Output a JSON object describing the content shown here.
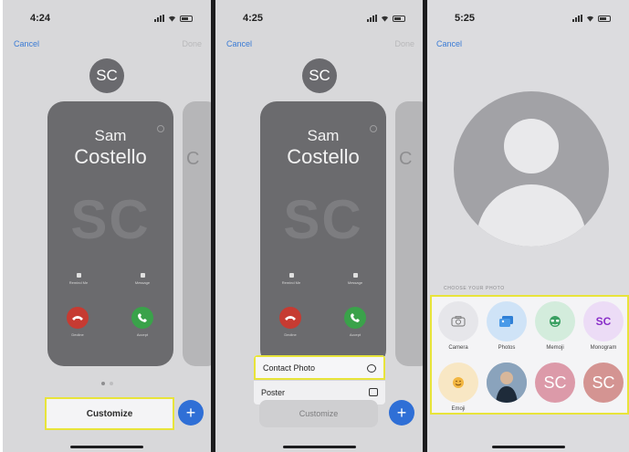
{
  "panels": [
    {
      "time": "4:24",
      "cancel": "Cancel",
      "done": "Done",
      "avatar_initials": "SC",
      "card": {
        "first_name": "Sam",
        "last_name": "Costello",
        "monogram": "SC",
        "remind_me": "Remind Me",
        "message": "Message",
        "decline": "Decline",
        "accept": "Accept"
      },
      "peek_letter": "C",
      "customize_label": "Customize",
      "plus": "+"
    },
    {
      "time": "4:25",
      "cancel": "Cancel",
      "done": "Done",
      "avatar_initials": "SC",
      "card": {
        "first_name": "Sam",
        "last_name": "Costello",
        "monogram": "SC",
        "remind_me": "Remind Me",
        "message": "Message",
        "decline": "Decline",
        "accept": "Accept"
      },
      "peek_letter": "C",
      "menu": [
        {
          "label": "Contact Photo",
          "icon": "person-circle-icon"
        },
        {
          "label": "Poster",
          "icon": "poster-icon"
        }
      ],
      "customize_label": "Customize",
      "plus": "+"
    },
    {
      "time": "5:25",
      "cancel": "Cancel",
      "choose_label": "CHOOSE YOUR PHOTO",
      "options": [
        {
          "label": "Camera",
          "icon": "camera-icon"
        },
        {
          "label": "Photos",
          "icon": "photos-icon"
        },
        {
          "label": "Memoji",
          "icon": "memoji-icon"
        },
        {
          "label": "Monogram",
          "text": "SC"
        },
        {
          "label": "Emoji",
          "icon": "emoji-icon"
        },
        {
          "label": "",
          "icon": "person-photo"
        },
        {
          "label": "",
          "text": "SC"
        },
        {
          "label": "",
          "text": "SC"
        }
      ]
    }
  ],
  "colors": {
    "accent": "#3a7bd5",
    "highlight": "#e8e43a",
    "decline": "#c63b32",
    "accept": "#3aa24a",
    "monogram_purple": "#8a2fc9"
  }
}
